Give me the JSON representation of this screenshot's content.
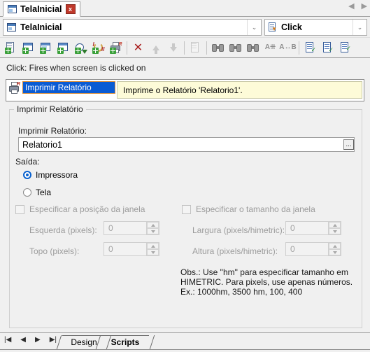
{
  "window": {
    "document_tab": {
      "label": "TelaInicial",
      "icon": "window-icon",
      "close": "x"
    },
    "nav": {
      "prev": "◀",
      "next": "▶"
    }
  },
  "selectors": {
    "screen": {
      "value": "TelaInicial",
      "icon": "window-icon",
      "arrow": "⌄"
    },
    "event": {
      "value": "Click",
      "icon": "event-script-icon",
      "arrow": "⌄"
    }
  },
  "toolbar": {
    "buttons": [
      {
        "name": "new-script",
        "title": "New Script"
      },
      {
        "name": "new-window",
        "title": "New Window"
      },
      {
        "name": "new-screen",
        "title": "New Screen"
      },
      {
        "name": "new-dialog",
        "title": "New Dialog"
      },
      {
        "name": "add-download",
        "title": "Add Download"
      },
      {
        "name": "add-loop",
        "title": "Add Loop"
      },
      {
        "name": "add-print",
        "title": "Add Print"
      },
      {
        "name": "delete",
        "title": "Delete"
      },
      {
        "name": "move-up",
        "title": "Move Up"
      },
      {
        "name": "move-down",
        "title": "Move Down"
      },
      {
        "name": "properties",
        "title": "Properties"
      },
      {
        "name": "find",
        "title": "Find"
      },
      {
        "name": "find-next",
        "title": "Find Next"
      },
      {
        "name": "find-previous",
        "title": "Find Previous"
      },
      {
        "name": "replace",
        "title": "Replace"
      },
      {
        "name": "sort-ab",
        "title": "Sort"
      },
      {
        "name": "validate-script",
        "title": "Validate Script"
      },
      {
        "name": "check-script",
        "title": "Check Script"
      },
      {
        "name": "run-script",
        "title": "Run Script"
      }
    ]
  },
  "hint": {
    "text": "Click: Fires when screen is clicked on"
  },
  "script_list": {
    "items": [
      {
        "name": "Imprimir Relatório",
        "description": "Imprime o Relatório 'Relatorio1'.",
        "selected": true,
        "icon": "print-report-icon"
      }
    ]
  },
  "form": {
    "group_title": "Imprimir Relatório",
    "report_label": "Imprimir Relatório:",
    "report_value": "Relatorio1",
    "browse_label": "...",
    "output_label": "Saída:",
    "output_options": [
      {
        "label": "Impressora",
        "selected": true
      },
      {
        "label": "Tela",
        "selected": false
      }
    ],
    "position": {
      "checkbox_label": "Especificar a posição da janela",
      "checked": false,
      "fields": [
        {
          "label": "Esquerda (pixels):",
          "value": "0"
        },
        {
          "label": "Topo (pixels):",
          "value": "0"
        }
      ]
    },
    "size": {
      "checkbox_label": "Especificar o tamanho da janela",
      "checked": false,
      "fields": [
        {
          "label": "Largura (pixels/himetric):",
          "value": "0"
        },
        {
          "label": "Altura (pixels/himetric):",
          "value": "0"
        }
      ]
    },
    "note": {
      "line1": "Obs.: Use \"hm\" para especificar tamanho em",
      "line2": "HIMETRIC. Para pixels, use apenas números.",
      "line3": "Ex.: 1000hm, 3500 hm, 100, 400"
    }
  },
  "bottom": {
    "nav": {
      "first": "|◀",
      "prev": "◀",
      "next": "▶",
      "last": "▶|"
    },
    "tabs": [
      {
        "label": "Design",
        "active": false
      },
      {
        "label": "Scripts",
        "active": true
      }
    ]
  },
  "colors": {
    "selection_blue": "#0a5bd3",
    "selection_border": "#d98f3c",
    "description_bg": "#fdfbd8",
    "radio_accent": "#0a62cf",
    "close_red": "#c0392b",
    "window_bg": "#f0f0f0"
  }
}
